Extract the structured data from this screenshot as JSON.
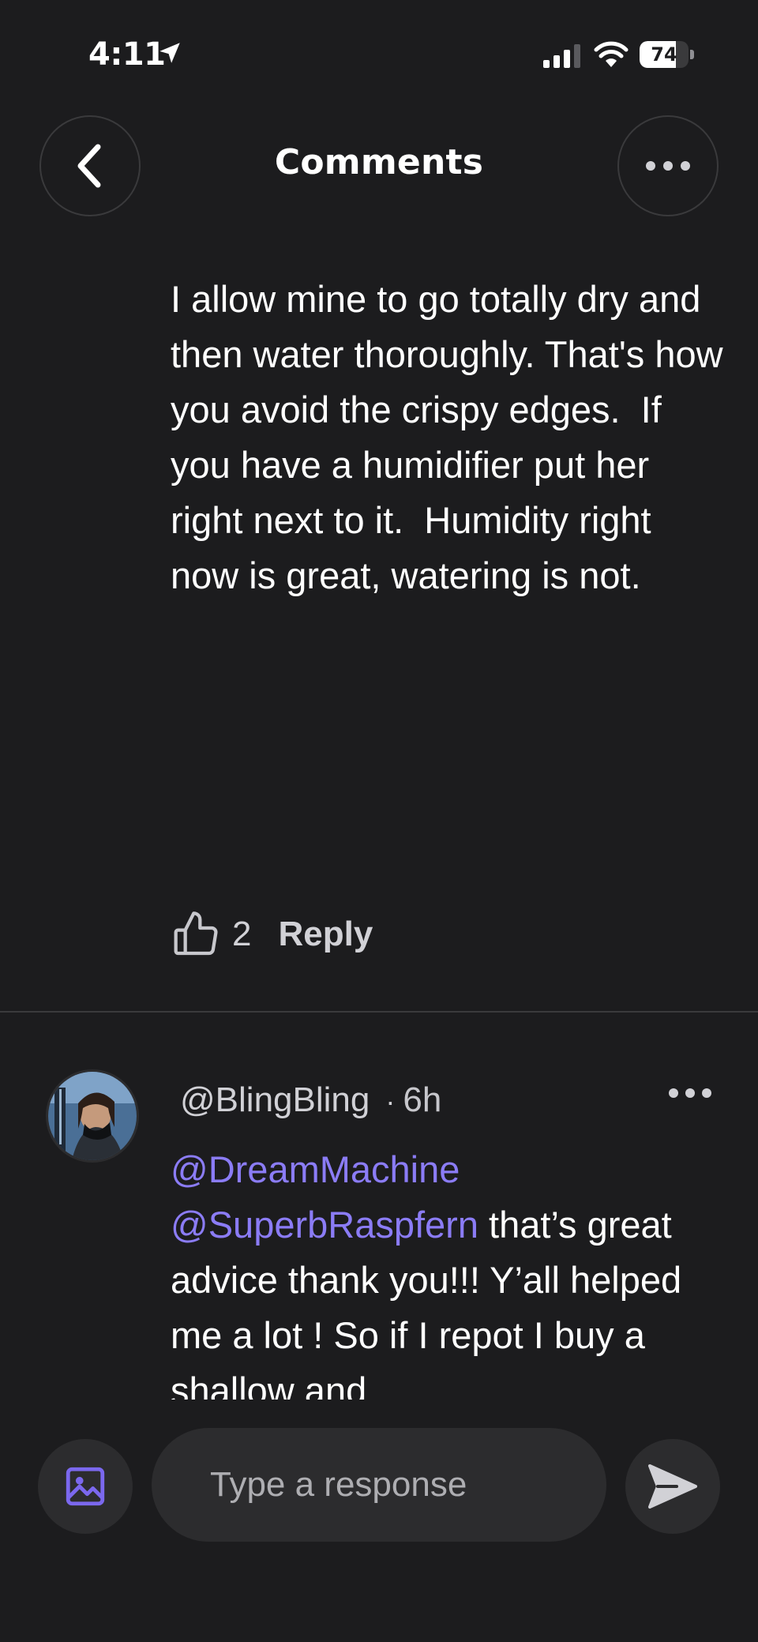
{
  "status_bar": {
    "time": "4:11",
    "battery": "74",
    "battery_level": 0.74,
    "icons": [
      "location-arrow-icon",
      "cellular-signal-icon",
      "wifi-icon",
      "battery-icon"
    ]
  },
  "header": {
    "title": "Comments",
    "back_icon": "chevron-left-icon",
    "more_icon": "more-horizontal-icon"
  },
  "comment": {
    "text": "I allow mine to go totally dry and then water thoroughly. That's how you avoid the crispy edges.  If you have a humidifier put her right next to it.  Humidity right now is great, watering is not.",
    "like_count": "2",
    "reply_label": "Reply"
  },
  "reply": {
    "username": "@BlingBling",
    "separator": "·",
    "time": "6h",
    "mentions": [
      "@DreamMachine",
      "@SuperbRaspfern"
    ],
    "text": "that’s great advice thank you!!! Y’all helped me a lot ! So if I repot I buy a shallow and"
  },
  "composer": {
    "placeholder": "Type a response",
    "value": ""
  },
  "colors": {
    "background": "#1c1c1e",
    "mention": "#8b7cf6",
    "accent": "#7b68ee",
    "surface": "#2c2c2e"
  }
}
